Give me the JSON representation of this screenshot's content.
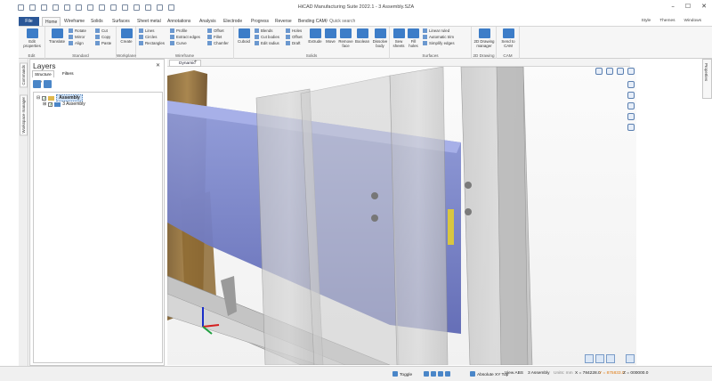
{
  "app": {
    "title": "HiCAD Manufacturing Suite 2022.1 - 3 Assembly.SZA"
  },
  "window_controls": [
    "–",
    "☐",
    "✕"
  ],
  "ribbon_tabs": [
    "File",
    "Home",
    "Wireframe",
    "Solids",
    "Surfaces",
    "Sheet metal",
    "Annotations",
    "Analysis",
    "Electrode",
    "Progress",
    "Reverse",
    "Bending CAM"
  ],
  "active_tab": "Home",
  "quick_search_placeholder": "Quick search",
  "right_menu": [
    "Style",
    "Themes",
    "Windows"
  ],
  "ribbon": {
    "edit": {
      "label": "Edit",
      "edit_properties": "Edit properties"
    },
    "standard": {
      "label": "Standard",
      "translate": "Translate",
      "rotate": "Rotate",
      "mirror": "Mirror",
      "align": "Align",
      "cut": "Cut",
      "copy": "Copy",
      "paste": "Paste"
    },
    "workplane": {
      "label": "Workplane",
      "create": "Create"
    },
    "wireframe": {
      "label": "Wireframe",
      "lines": "Lines",
      "circles": "Circles",
      "rectangles": "Rectangles",
      "profile": "Profile",
      "extract_edges": "Extract edges",
      "curve": "Curve",
      "offset": "Offset",
      "fillet": "Fillet",
      "chamfer": "Chamfer"
    },
    "solids": {
      "label": "Solids",
      "cuboid": "Cuboid",
      "blends": "Blends",
      "cut_bodies": "Cut bodies",
      "edit_radius": "Edit radius",
      "holes": "Holes",
      "offset": "Offset",
      "draft": "Draft",
      "extrude": "Extrude",
      "move": "Move",
      "remove_face": "Remove face",
      "boolean": "Boolean",
      "dissolve_body": "Dissolve body"
    },
    "surfaces": {
      "label": "Surfaces",
      "sew_sheets": "Sew sheets",
      "fill_holes": "Fill holes",
      "linear_ruled": "Linear ruled",
      "automatic_trim": "Automatic trim",
      "simplify_edges": "Simplify edges"
    },
    "drawing2d": {
      "label": "2D Drawing",
      "manager": "2D Drawing manager"
    },
    "cam": {
      "label": "CAM",
      "send": "Send to CAM"
    }
  },
  "left_strip": [
    "Commands",
    "Workspace manager"
  ],
  "layers": {
    "title": "Layers",
    "tabs": [
      "Structure tree",
      "Filters"
    ],
    "tree": [
      {
        "label": "Assembly",
        "selected": true
      },
      {
        "label": "3 Assembly",
        "selected": false
      }
    ]
  },
  "viewport": {
    "tab_label": "Dynamic",
    "add_tab": "+"
  },
  "properties_tab": "Properties",
  "statusbar": {
    "toggle": "Toggle",
    "plane": "Absolute XY Top",
    "view": "View ABS",
    "part": "3 Assembly",
    "units": "Units: mm",
    "x": "X = 784228.0",
    "y": "Y = 875833.0",
    "z": "Z = 000000.0"
  }
}
